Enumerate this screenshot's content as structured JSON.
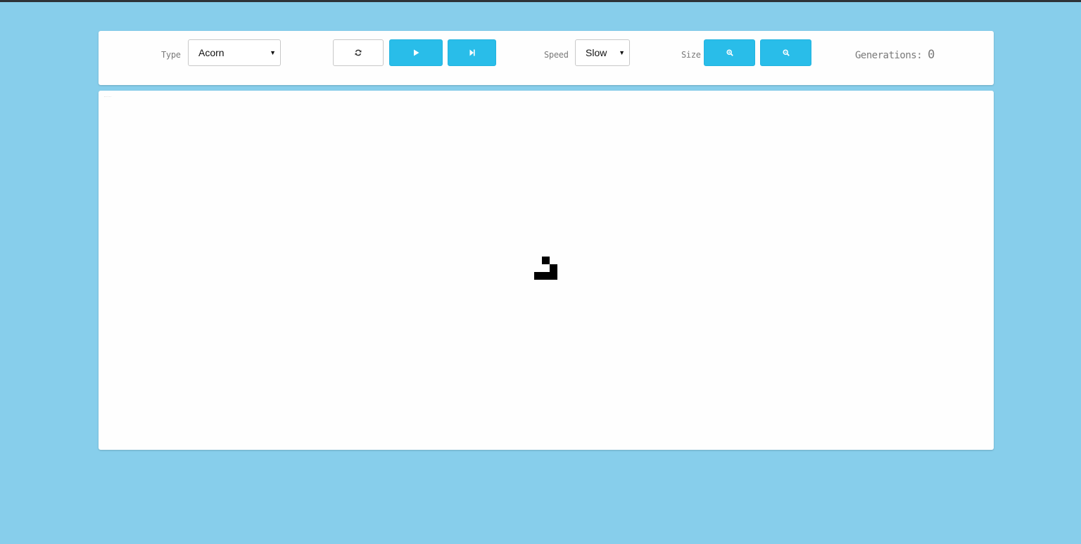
{
  "controls": {
    "type_label": "Type",
    "type_value": "Acorn",
    "speed_label": "Speed",
    "speed_value": "Slow",
    "size_label": "Size",
    "reset_icon": "refresh-icon",
    "play_icon": "play-icon",
    "step_icon": "step-forward-icon",
    "zoom_in_icon": "zoom-in-icon",
    "zoom_out_icon": "zoom-out-icon",
    "generations_label": "Generations:",
    "generations_value": "0"
  },
  "colors": {
    "background": "#87ceeb",
    "accent": "#29bde9",
    "cell": "#000000"
  },
  "board": {
    "pattern": "Acorn",
    "cells": [
      {
        "col": 1,
        "row": 0
      },
      {
        "col": 2,
        "row": 1
      },
      {
        "col": 0,
        "row": 2
      },
      {
        "col": 1,
        "row": 2
      },
      {
        "col": 2,
        "row": 2
      }
    ]
  }
}
